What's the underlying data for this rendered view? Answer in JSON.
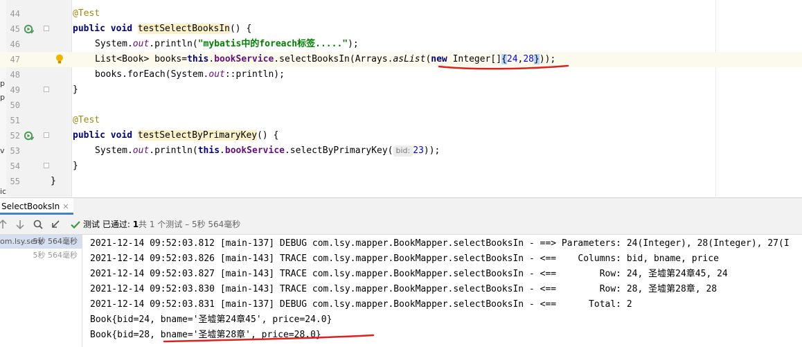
{
  "left_strip": [
    "p",
    "p",
    "v",
    "ic"
  ],
  "editor": {
    "lines": [
      {
        "num": "44"
      },
      {
        "num": "45",
        "annotation": "@Test"
      },
      {
        "num": "46"
      },
      {
        "num": "47"
      },
      {
        "num": "48"
      },
      {
        "num": "49"
      },
      {
        "num": "50"
      },
      {
        "num": "51"
      },
      {
        "num": "52"
      },
      {
        "num": "53"
      },
      {
        "num": "54"
      },
      {
        "num": "55"
      }
    ],
    "tokens": {
      "test1_ann": "@Test",
      "public_void": "public void ",
      "m1_name": "testSelectBooksIn",
      "m1_tail": "() {",
      "sys1": "System.",
      "out": "out",
      "println_open": ".println(",
      "str1": "\"mybatis中的foreach标签.....\"",
      "close_semi": ");",
      "list_decl": "List<Book> books=",
      "this_kw": "this",
      "dot": ".",
      "bookService": "bookService",
      "select_in": ".selectBooksIn(Arrays.",
      "asList": "asList",
      "paren_open": "(",
      "new_kw": "new",
      "integer_arr": " Integer[]",
      "brace_open": "{",
      "n24": "24",
      "comma": ",",
      "n28": "28",
      "brace_close": "}",
      "end_47": "));",
      "foreach_pre": "books.forEach(System.",
      "foreach_post": "::println);",
      "close_brace_inner": "}",
      "test2_ann": "@Test",
      "m2_name": "testSelectByPrimaryKey",
      "m2_tail": "() {",
      "sys2": "System.",
      "println_this": ".println(",
      "select_pk": ".selectByPrimaryKey(",
      "hint_label": "bid:",
      "n23": "23",
      "end_53": "));",
      "close_brace_outer": "}"
    }
  },
  "run_tab": {
    "label": "SelectBooksIn",
    "close": "✕"
  },
  "status": {
    "label": "测试 已通过: ",
    "passed": "1",
    "detail": "共 1 个测试 – 5秒 564毫秒"
  },
  "tree": [
    {
      "name": "om.lsy.serv",
      "time": "5秒 564毫秒",
      "selected": true
    },
    {
      "name": "",
      "time": "5秒 564毫秒",
      "selected": false
    }
  ],
  "console": [
    "2021-12-14 09:52:03.812 [main-137] DEBUG com.lsy.mapper.BookMapper.selectBooksIn - ==> Parameters: 24(Integer), 28(Integer), 27(I",
    "2021-12-14 09:52:03.826 [main-143] TRACE com.lsy.mapper.BookMapper.selectBooksIn - <==    Columns: bid, bname, price",
    "2021-12-14 09:52:03.827 [main-143] TRACE com.lsy.mapper.BookMapper.selectBooksIn - <==        Row: 24, 圣墟第24章45, 24",
    "2021-12-14 09:52:03.830 [main-143] TRACE com.lsy.mapper.BookMapper.selectBooksIn - <==        Row: 28, 圣墟第28章, 28",
    "2021-12-14 09:52:03.831 [main-137] DEBUG com.lsy.mapper.BookMapper.selectBooksIn - <==      Total: 2",
    "Book{bid=24, bname='圣墟第24章45', price=24.0}",
    "Book{bid=28, bname='圣墟第28章', price=28.0}"
  ],
  "colors": {
    "annotation": "#9e880d",
    "keyword": "#000080",
    "string": "#008000",
    "number": "#0000ff",
    "field": "#660e7a",
    "method_highlight": "#faf1c8",
    "current_line": "#fcfaed",
    "red_ink": "#e0201a",
    "pass_green": "#3c9a3c"
  }
}
